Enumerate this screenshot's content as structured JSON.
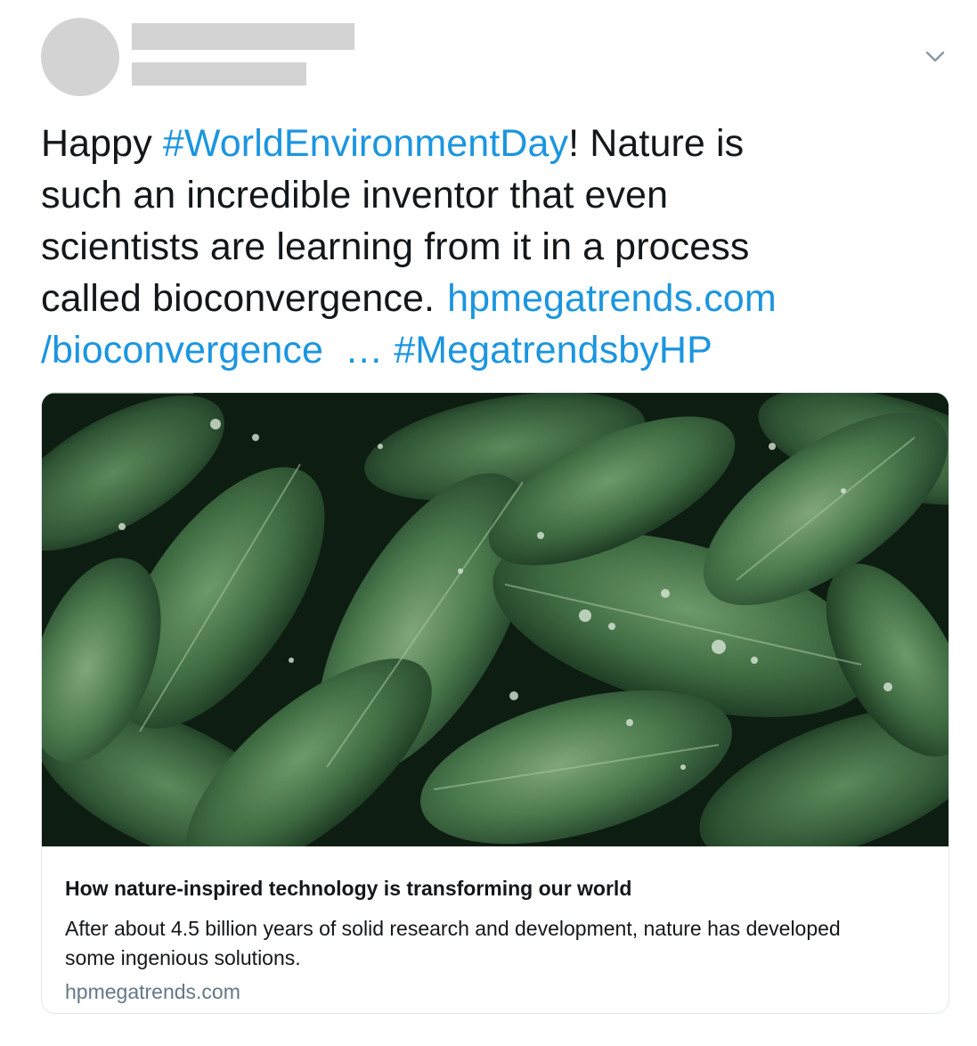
{
  "tweet": {
    "text_lines": [
      [
        {
          "t": "Happy ",
          "link": false
        },
        {
          "t": "#WorldEnvironmentDay",
          "link": true
        },
        {
          "t": "! Nature is",
          "link": false
        }
      ],
      [
        {
          "t": "such an incredible inventor that even",
          "link": false
        }
      ],
      [
        {
          "t": "scientists are learning from it in a process",
          "link": false
        }
      ],
      [
        {
          "t": "called bioconvergence.",
          "link": false
        },
        {
          "t": "hpmegatrends.com",
          "link": true
        }
      ],
      [
        {
          "t": "/bioconvergence",
          "link": true
        },
        {
          "t": "… #MegatrendsbyHP",
          "link": true
        }
      ]
    ],
    "hashtag": "#WorldEnvironmentDay",
    "link_text_1": "hpmegatrends.com",
    "link_text_2": "/bioconvergence",
    "ellipsis_hashtag": "… #MegatrendsbyHP",
    "caret_icon": "chevron-down-icon"
  },
  "card": {
    "title": "How nature-inspired technology is transforming our world",
    "description": "After about 4.5 billion years of solid research and development, nature has developed some ingenious solutions.",
    "domain": "hpmegatrends.com",
    "image_subject": "leaves-photo"
  },
  "colors": {
    "link": "#1b95e0",
    "text": "#14171a",
    "muted": "#657786",
    "placeholder": "#d3d3d3",
    "border": "#e1e8ed"
  }
}
